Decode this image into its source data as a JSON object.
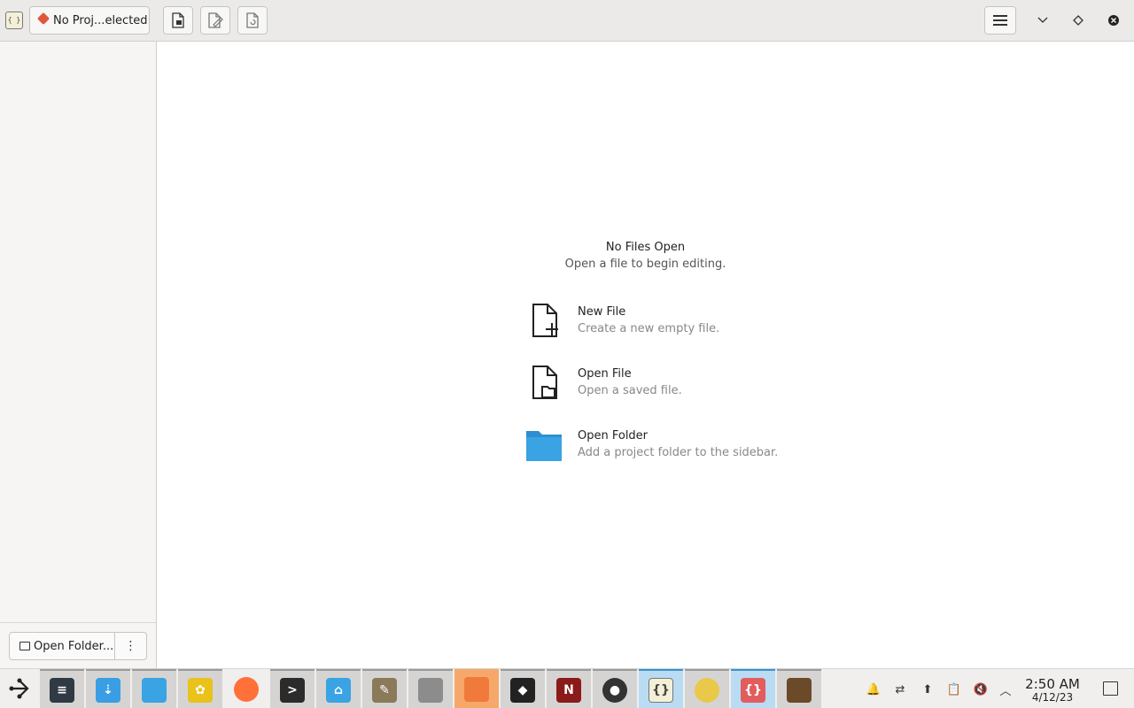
{
  "header": {
    "project_selector_label": "No Proj...elected",
    "toolbar_buttons": [
      "new-file-icon",
      "save-as-icon",
      "revert-file-icon"
    ]
  },
  "sidebar": {
    "open_folder_label": "Open Folder...",
    "more_label": "⋮"
  },
  "welcome": {
    "title": "No Files Open",
    "subtitle": "Open a file to begin editing.",
    "actions": [
      {
        "label": "New File",
        "description": "Create a new empty file."
      },
      {
        "label": "Open File",
        "description": "Open a saved file."
      },
      {
        "label": "Open Folder",
        "description": "Add a project folder to the sidebar."
      }
    ]
  },
  "taskbar": {
    "apps": [
      "system-settings",
      "app-center",
      "files",
      "sunflower",
      "firefox",
      "terminal",
      "home-folder",
      "gimp",
      "document-viewer",
      "presentation",
      "inkscape",
      "media-app",
      "panda",
      "code-editor",
      "rabbit-app",
      "code-editor-window",
      "detective-app"
    ],
    "clock_time": "2:50 AM",
    "clock_date": "4/12/23"
  },
  "colors": {
    "accent": "#3c8fd1",
    "folder_blue": "#3aa3e3",
    "git_red": "#e0573c"
  }
}
